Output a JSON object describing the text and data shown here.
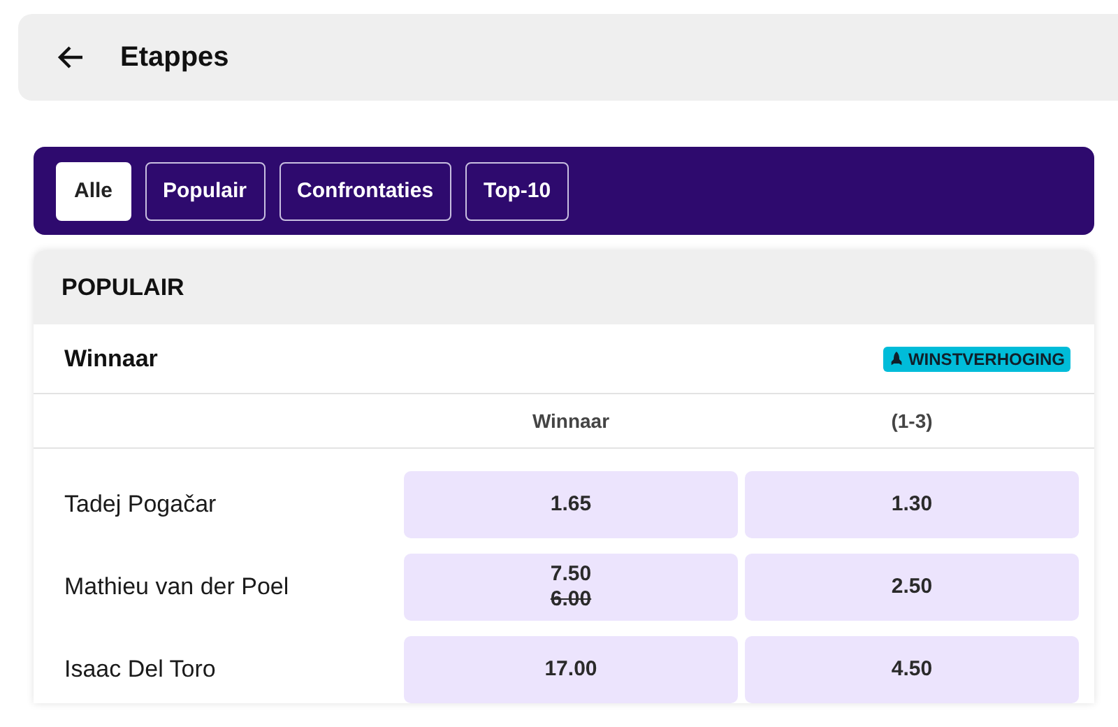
{
  "header": {
    "title": "Etappes"
  },
  "filters": [
    {
      "label": "Alle",
      "selected": true
    },
    {
      "label": "Populair",
      "selected": false
    },
    {
      "label": "Confrontaties",
      "selected": false
    },
    {
      "label": "Top-10",
      "selected": false
    }
  ],
  "section": {
    "title": "POPULAIR"
  },
  "market": {
    "title": "Winnaar",
    "badge": "WINSTVERHOGING",
    "columns": [
      "Winnaar",
      "(1-3)"
    ],
    "rows": [
      {
        "name": "Tadej Pogačar",
        "odds": [
          {
            "value": "1.65"
          },
          {
            "value": "1.30"
          }
        ]
      },
      {
        "name": "Mathieu van der Poel",
        "odds": [
          {
            "value": "7.50",
            "previous": "6.00"
          },
          {
            "value": "2.50"
          }
        ]
      },
      {
        "name": "Isaac Del Toro",
        "odds": [
          {
            "value": "17.00"
          },
          {
            "value": "4.50"
          }
        ]
      }
    ]
  }
}
